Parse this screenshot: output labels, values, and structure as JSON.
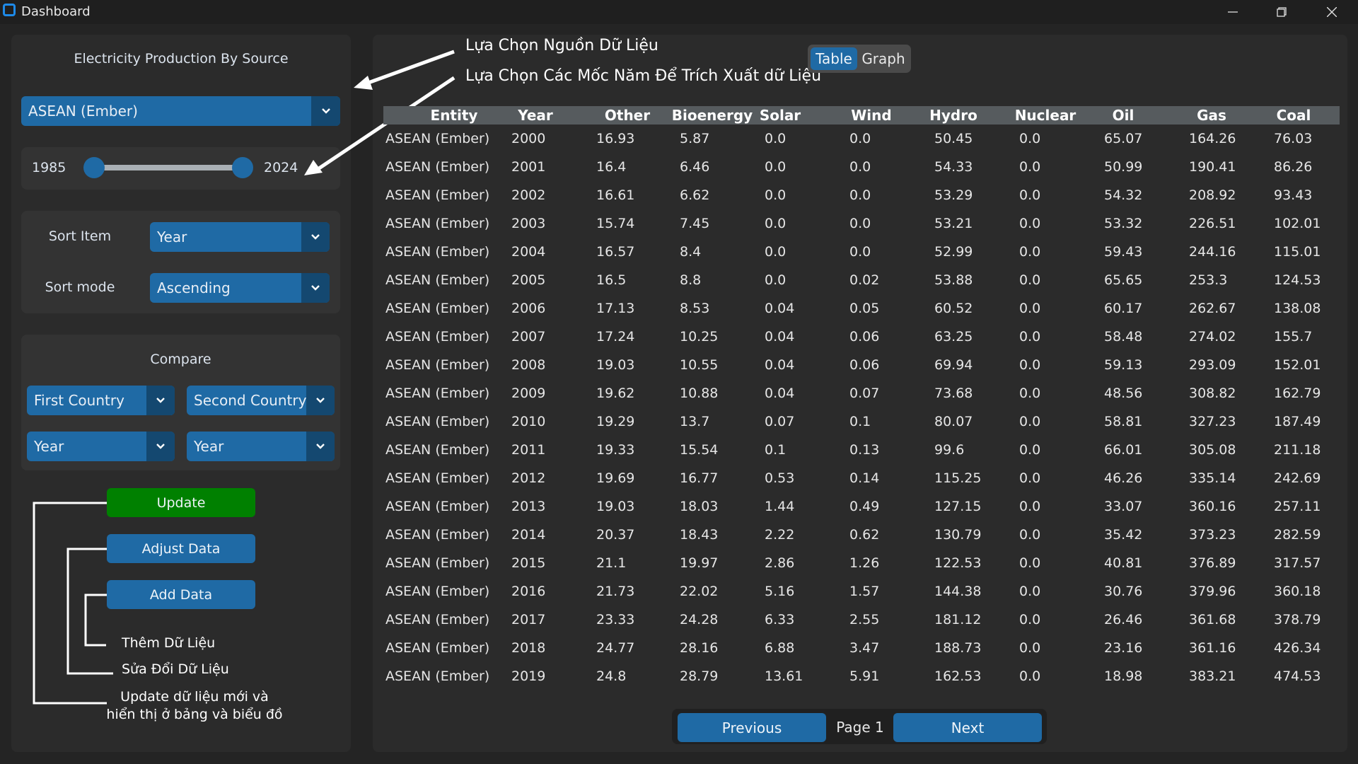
{
  "window": {
    "title": "Dashboard"
  },
  "sidebar": {
    "heading": "Electricity Production By Source",
    "source_combo": "ASEAN (Ember)",
    "slider": {
      "min_label": "1985",
      "max_label": "2024",
      "low_value": 1985,
      "high_value": 2024
    },
    "sort": {
      "item_label": "Sort Item",
      "item_value": "Year",
      "mode_label": "Sort mode",
      "mode_value": "Ascending"
    },
    "compare": {
      "heading": "Compare",
      "first_country": "First Country",
      "second_country": "Second Country",
      "first_year": "Year",
      "second_year": "Year"
    },
    "buttons": {
      "update": "Update",
      "adjust": "Adjust Data",
      "add": "Add Data"
    },
    "notes": {
      "add": "Thêm Dữ Liệu",
      "adjust": "Sửa Đổi Dữ Liệu",
      "update_line1": "Update dữ liệu mới và",
      "update_line2": "hiển thị ở bảng và biểu đồ"
    }
  },
  "annotations": {
    "source": "Lựa Chọn Nguồn Dữ Liệu",
    "years": "Lựa Chọn Các Mốc Năm Để Trích Xuất dữ Liệu"
  },
  "view_toggle": {
    "table": "Table",
    "graph": "Graph",
    "active": "Table"
  },
  "table": {
    "columns": [
      "Entity",
      "Year",
      "Other",
      "Bioenergy",
      "Solar",
      "Wind",
      "Hydro",
      "Nuclear",
      "Oil",
      "Gas",
      "Coal"
    ],
    "rows": [
      [
        "ASEAN (Ember)",
        "2000",
        "16.93",
        "5.87",
        "0.0",
        "0.0",
        "50.45",
        "0.0",
        "65.07",
        "164.26",
        "76.03"
      ],
      [
        "ASEAN (Ember)",
        "2001",
        "16.4",
        "6.46",
        "0.0",
        "0.0",
        "54.33",
        "0.0",
        "50.99",
        "190.41",
        "86.26"
      ],
      [
        "ASEAN (Ember)",
        "2002",
        "16.61",
        "6.62",
        "0.0",
        "0.0",
        "53.29",
        "0.0",
        "54.32",
        "208.92",
        "93.43"
      ],
      [
        "ASEAN (Ember)",
        "2003",
        "15.74",
        "7.45",
        "0.0",
        "0.0",
        "53.21",
        "0.0",
        "53.32",
        "226.51",
        "102.01"
      ],
      [
        "ASEAN (Ember)",
        "2004",
        "16.57",
        "8.4",
        "0.0",
        "0.0",
        "52.99",
        "0.0",
        "59.43",
        "244.16",
        "115.01"
      ],
      [
        "ASEAN (Ember)",
        "2005",
        "16.5",
        "8.8",
        "0.0",
        "0.02",
        "53.88",
        "0.0",
        "65.65",
        "253.3",
        "124.53"
      ],
      [
        "ASEAN (Ember)",
        "2006",
        "17.13",
        "8.53",
        "0.04",
        "0.05",
        "60.52",
        "0.0",
        "60.17",
        "262.67",
        "138.08"
      ],
      [
        "ASEAN (Ember)",
        "2007",
        "17.24",
        "10.25",
        "0.04",
        "0.06",
        "63.25",
        "0.0",
        "58.48",
        "274.02",
        "155.7"
      ],
      [
        "ASEAN (Ember)",
        "2008",
        "19.03",
        "10.55",
        "0.04",
        "0.06",
        "69.94",
        "0.0",
        "59.13",
        "293.09",
        "152.01"
      ],
      [
        "ASEAN (Ember)",
        "2009",
        "19.62",
        "10.88",
        "0.04",
        "0.07",
        "73.68",
        "0.0",
        "48.56",
        "308.82",
        "162.79"
      ],
      [
        "ASEAN (Ember)",
        "2010",
        "19.29",
        "13.7",
        "0.07",
        "0.1",
        "80.07",
        "0.0",
        "58.81",
        "327.23",
        "187.49"
      ],
      [
        "ASEAN (Ember)",
        "2011",
        "19.33",
        "15.54",
        "0.1",
        "0.13",
        "99.6",
        "0.0",
        "66.01",
        "305.08",
        "211.18"
      ],
      [
        "ASEAN (Ember)",
        "2012",
        "19.69",
        "16.77",
        "0.53",
        "0.14",
        "115.25",
        "0.0",
        "46.26",
        "335.14",
        "242.69"
      ],
      [
        "ASEAN (Ember)",
        "2013",
        "19.03",
        "18.03",
        "1.44",
        "0.49",
        "127.15",
        "0.0",
        "33.07",
        "360.16",
        "257.11"
      ],
      [
        "ASEAN (Ember)",
        "2014",
        "20.37",
        "18.43",
        "2.22",
        "0.62",
        "130.79",
        "0.0",
        "35.42",
        "373.23",
        "282.59"
      ],
      [
        "ASEAN (Ember)",
        "2015",
        "21.1",
        "19.97",
        "2.86",
        "1.26",
        "122.53",
        "0.0",
        "40.81",
        "376.89",
        "317.57"
      ],
      [
        "ASEAN (Ember)",
        "2016",
        "21.73",
        "22.02",
        "5.16",
        "1.57",
        "144.38",
        "0.0",
        "30.76",
        "379.96",
        "360.18"
      ],
      [
        "ASEAN (Ember)",
        "2017",
        "23.33",
        "24.28",
        "6.33",
        "2.55",
        "181.12",
        "0.0",
        "26.46",
        "361.68",
        "378.79"
      ],
      [
        "ASEAN (Ember)",
        "2018",
        "24.77",
        "28.16",
        "6.88",
        "3.47",
        "188.73",
        "0.0",
        "23.16",
        "361.16",
        "426.34"
      ],
      [
        "ASEAN (Ember)",
        "2019",
        "24.8",
        "28.79",
        "13.61",
        "5.91",
        "162.53",
        "0.0",
        "18.98",
        "383.21",
        "474.53"
      ]
    ]
  },
  "pagination": {
    "previous": "Previous",
    "page": "Page 1",
    "next": "Next"
  },
  "colors": {
    "accent": "#1f6aa5",
    "accent_dark": "#144870",
    "update_green": "#008000"
  }
}
